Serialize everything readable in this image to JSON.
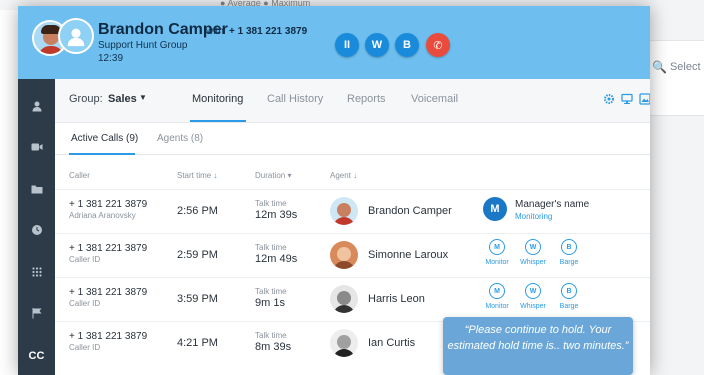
{
  "background": {
    "legend": "● Average   ● Maximum",
    "select_label": "Select"
  },
  "call": {
    "name": "Brandon Camper",
    "with_label": "with",
    "number": "+ 1 381 221 3879",
    "group": "Support Hunt Group",
    "time": "12:39",
    "controls": [
      {
        "label": "II",
        "icon": "pause-icon"
      },
      {
        "label": "W",
        "icon": "whisper-icon"
      },
      {
        "label": "B",
        "icon": "barge-icon"
      },
      {
        "label": "✆",
        "icon": "hangup-icon"
      }
    ]
  },
  "sidebar": {
    "items": [
      {
        "icon": "user-icon",
        "glyph": "👤"
      },
      {
        "icon": "video-icon",
        "glyph": "■"
      },
      {
        "icon": "folder-icon",
        "glyph": "▬"
      },
      {
        "icon": "clock-icon",
        "glyph": "●"
      },
      {
        "icon": "dialpad-icon",
        "glyph": "⠿"
      },
      {
        "icon": "flag-icon",
        "glyph": "⚑"
      }
    ],
    "cc_label": "CC"
  },
  "nav": {
    "group_label": "Group:",
    "group_value": "Sales",
    "tabs": [
      "Monitoring",
      "Call History",
      "Reports",
      "Voicemail"
    ],
    "active_tab": "Monitoring"
  },
  "subtabs": {
    "items": [
      "Active Calls (9)",
      "Agents (8)"
    ],
    "active": "Active Calls (9)"
  },
  "table": {
    "headers": {
      "caller": "Caller",
      "start": "Start time",
      "start_sort": "↓",
      "duration": "Duration",
      "duration_sort": "▾",
      "agent": "Agent",
      "agent_sort": "↓"
    },
    "rows": [
      {
        "number": "+ 1 381 221 3879",
        "sub": "Adriana Aranovsky",
        "start": "2:56 PM",
        "dur_label": "Talk time",
        "dur": "12m 39s",
        "agent": "Brandon Camper"
      },
      {
        "number": "+ 1 381 221 3879",
        "sub": "Caller ID",
        "start": "2:59 PM",
        "dur_label": "Talk time",
        "dur": "12m 49s",
        "agent": "Simonne Laroux"
      },
      {
        "number": "+ 1 381 221 3879",
        "sub": "Caller ID",
        "start": "3:59 PM",
        "dur_label": "Talk time",
        "dur": "9m 1s",
        "agent": "Harris Leon"
      },
      {
        "number": "+ 1 381 221 3879",
        "sub": "Caller ID",
        "start": "4:21 PM",
        "dur_label": "Talk time",
        "dur": "8m 39s",
        "agent": "Ian Curtis"
      }
    ],
    "manager": {
      "badge": "M",
      "name": "Manager's name",
      "status": "Monitoring"
    },
    "actions": [
      {
        "badge": "M",
        "label": "Monitor"
      },
      {
        "badge": "W",
        "label": "Whisper"
      },
      {
        "badge": "B",
        "label": "Barge"
      }
    ]
  },
  "tooltip": {
    "text": "“Please continue to hold. Your estimated hold time is.. two minutes.”"
  },
  "colors": {
    "header": "#6ebfef",
    "accent": "#2b9be8",
    "sidebar": "#2d3a47",
    "hangup": "#e94b3c"
  }
}
